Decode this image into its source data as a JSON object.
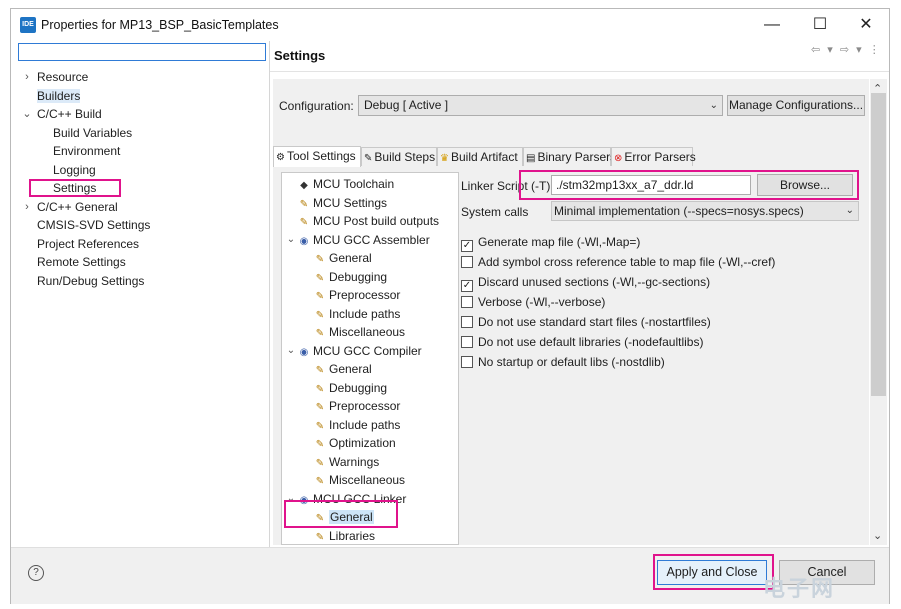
{
  "window": {
    "app_icon": "IDE",
    "title": "Properties for MP13_BSP_BasicTemplates",
    "controls": {
      "minimize": "—",
      "maximize": "☐",
      "close": "✕"
    }
  },
  "filter": {
    "value": ""
  },
  "nav": {
    "items": [
      {
        "label": "Resource",
        "arrow": "›"
      },
      {
        "label": "Builders",
        "arrow": ""
      },
      {
        "label": "C/C++ Build",
        "arrow": "⌄"
      },
      {
        "label": "Build Variables",
        "arrow": ""
      },
      {
        "label": "Environment",
        "arrow": ""
      },
      {
        "label": "Logging",
        "arrow": ""
      },
      {
        "label": "Settings",
        "arrow": ""
      },
      {
        "label": "C/C++ General",
        "arrow": "›"
      },
      {
        "label": "CMSIS-SVD Settings",
        "arrow": ""
      },
      {
        "label": "Project References",
        "arrow": ""
      },
      {
        "label": "Remote Settings",
        "arrow": ""
      },
      {
        "label": "Run/Debug Settings",
        "arrow": ""
      }
    ]
  },
  "header": {
    "title": "Settings",
    "nav_glyphs": "⇦ ▾ ⇨ ▾ ⋮"
  },
  "configuration": {
    "label": "Configuration:",
    "value": "Debug  [ Active ]",
    "manage_button": "Manage Configurations..."
  },
  "tabs": [
    {
      "label": "Tool Settings",
      "icon": "tool-settings-icon",
      "active": true
    },
    {
      "label": "Build Steps",
      "icon": "build-steps-icon",
      "active": false
    },
    {
      "label": "Build Artifact",
      "icon": "build-artifact-icon",
      "active": false
    },
    {
      "label": "Binary Parsers",
      "icon": "binary-parsers-icon",
      "active": false
    },
    {
      "label": "Error Parsers",
      "icon": "error-parsers-icon",
      "active": false
    }
  ],
  "tool_tree": [
    {
      "label": "MCU Toolchain",
      "level": 0,
      "arrow": "",
      "icon": "toolchain-icon"
    },
    {
      "label": "MCU Settings",
      "level": 0,
      "arrow": "",
      "icon": "settings-icon"
    },
    {
      "label": "MCU Post build outputs",
      "level": 0,
      "arrow": "",
      "icon": "settings-icon"
    },
    {
      "label": "MCU GCC Assembler",
      "level": 0,
      "arrow": "⌄",
      "icon": "tool-icon"
    },
    {
      "label": "General",
      "level": 1,
      "arrow": "",
      "icon": "settings-icon"
    },
    {
      "label": "Debugging",
      "level": 1,
      "arrow": "",
      "icon": "settings-icon"
    },
    {
      "label": "Preprocessor",
      "level": 1,
      "arrow": "",
      "icon": "settings-icon"
    },
    {
      "label": "Include paths",
      "level": 1,
      "arrow": "",
      "icon": "settings-icon"
    },
    {
      "label": "Miscellaneous",
      "level": 1,
      "arrow": "",
      "icon": "settings-icon"
    },
    {
      "label": "MCU GCC Compiler",
      "level": 0,
      "arrow": "⌄",
      "icon": "tool-icon"
    },
    {
      "label": "General",
      "level": 1,
      "arrow": "",
      "icon": "settings-icon"
    },
    {
      "label": "Debugging",
      "level": 1,
      "arrow": "",
      "icon": "settings-icon"
    },
    {
      "label": "Preprocessor",
      "level": 1,
      "arrow": "",
      "icon": "settings-icon"
    },
    {
      "label": "Include paths",
      "level": 1,
      "arrow": "",
      "icon": "settings-icon"
    },
    {
      "label": "Optimization",
      "level": 1,
      "arrow": "",
      "icon": "settings-icon"
    },
    {
      "label": "Warnings",
      "level": 1,
      "arrow": "",
      "icon": "settings-icon"
    },
    {
      "label": "Miscellaneous",
      "level": 1,
      "arrow": "",
      "icon": "settings-icon"
    },
    {
      "label": "MCU GCC Linker",
      "level": 0,
      "arrow": "⌄",
      "icon": "tool-icon"
    },
    {
      "label": "General",
      "level": 1,
      "arrow": "",
      "icon": "settings-icon",
      "selected": true
    },
    {
      "label": "Libraries",
      "level": 1,
      "arrow": "",
      "icon": "settings-icon"
    }
  ],
  "linker": {
    "script_label": "Linker Script (-T)",
    "script_value": "./stm32mp13xx_a7_ddr.ld",
    "browse_button": "Browse...",
    "syscalls_label": "System calls",
    "syscalls_value": "Minimal implementation (--specs=nosys.specs)",
    "options": [
      {
        "label": "Generate map file (-Wl,-Map=)",
        "checked": true
      },
      {
        "label": "Add symbol cross reference table to map file (-Wl,--cref)",
        "checked": false
      },
      {
        "label": "Discard unused sections (-Wl,--gc-sections)",
        "checked": true
      },
      {
        "label": "Verbose (-Wl,--verbose)",
        "checked": false
      },
      {
        "label": "Do not use standard start files (-nostartfiles)",
        "checked": false
      },
      {
        "label": "Do not use default libraries (-nodefaultlibs)",
        "checked": false
      },
      {
        "label": "No startup or default libs (-nostdlib)",
        "checked": false
      }
    ]
  },
  "footer": {
    "help": "?",
    "apply_button": "Apply and Close",
    "cancel_button": "Cancel"
  },
  "watermark": "电子网",
  "colors": {
    "highlight": "#e0138c",
    "accent": "#2f7bd6"
  }
}
